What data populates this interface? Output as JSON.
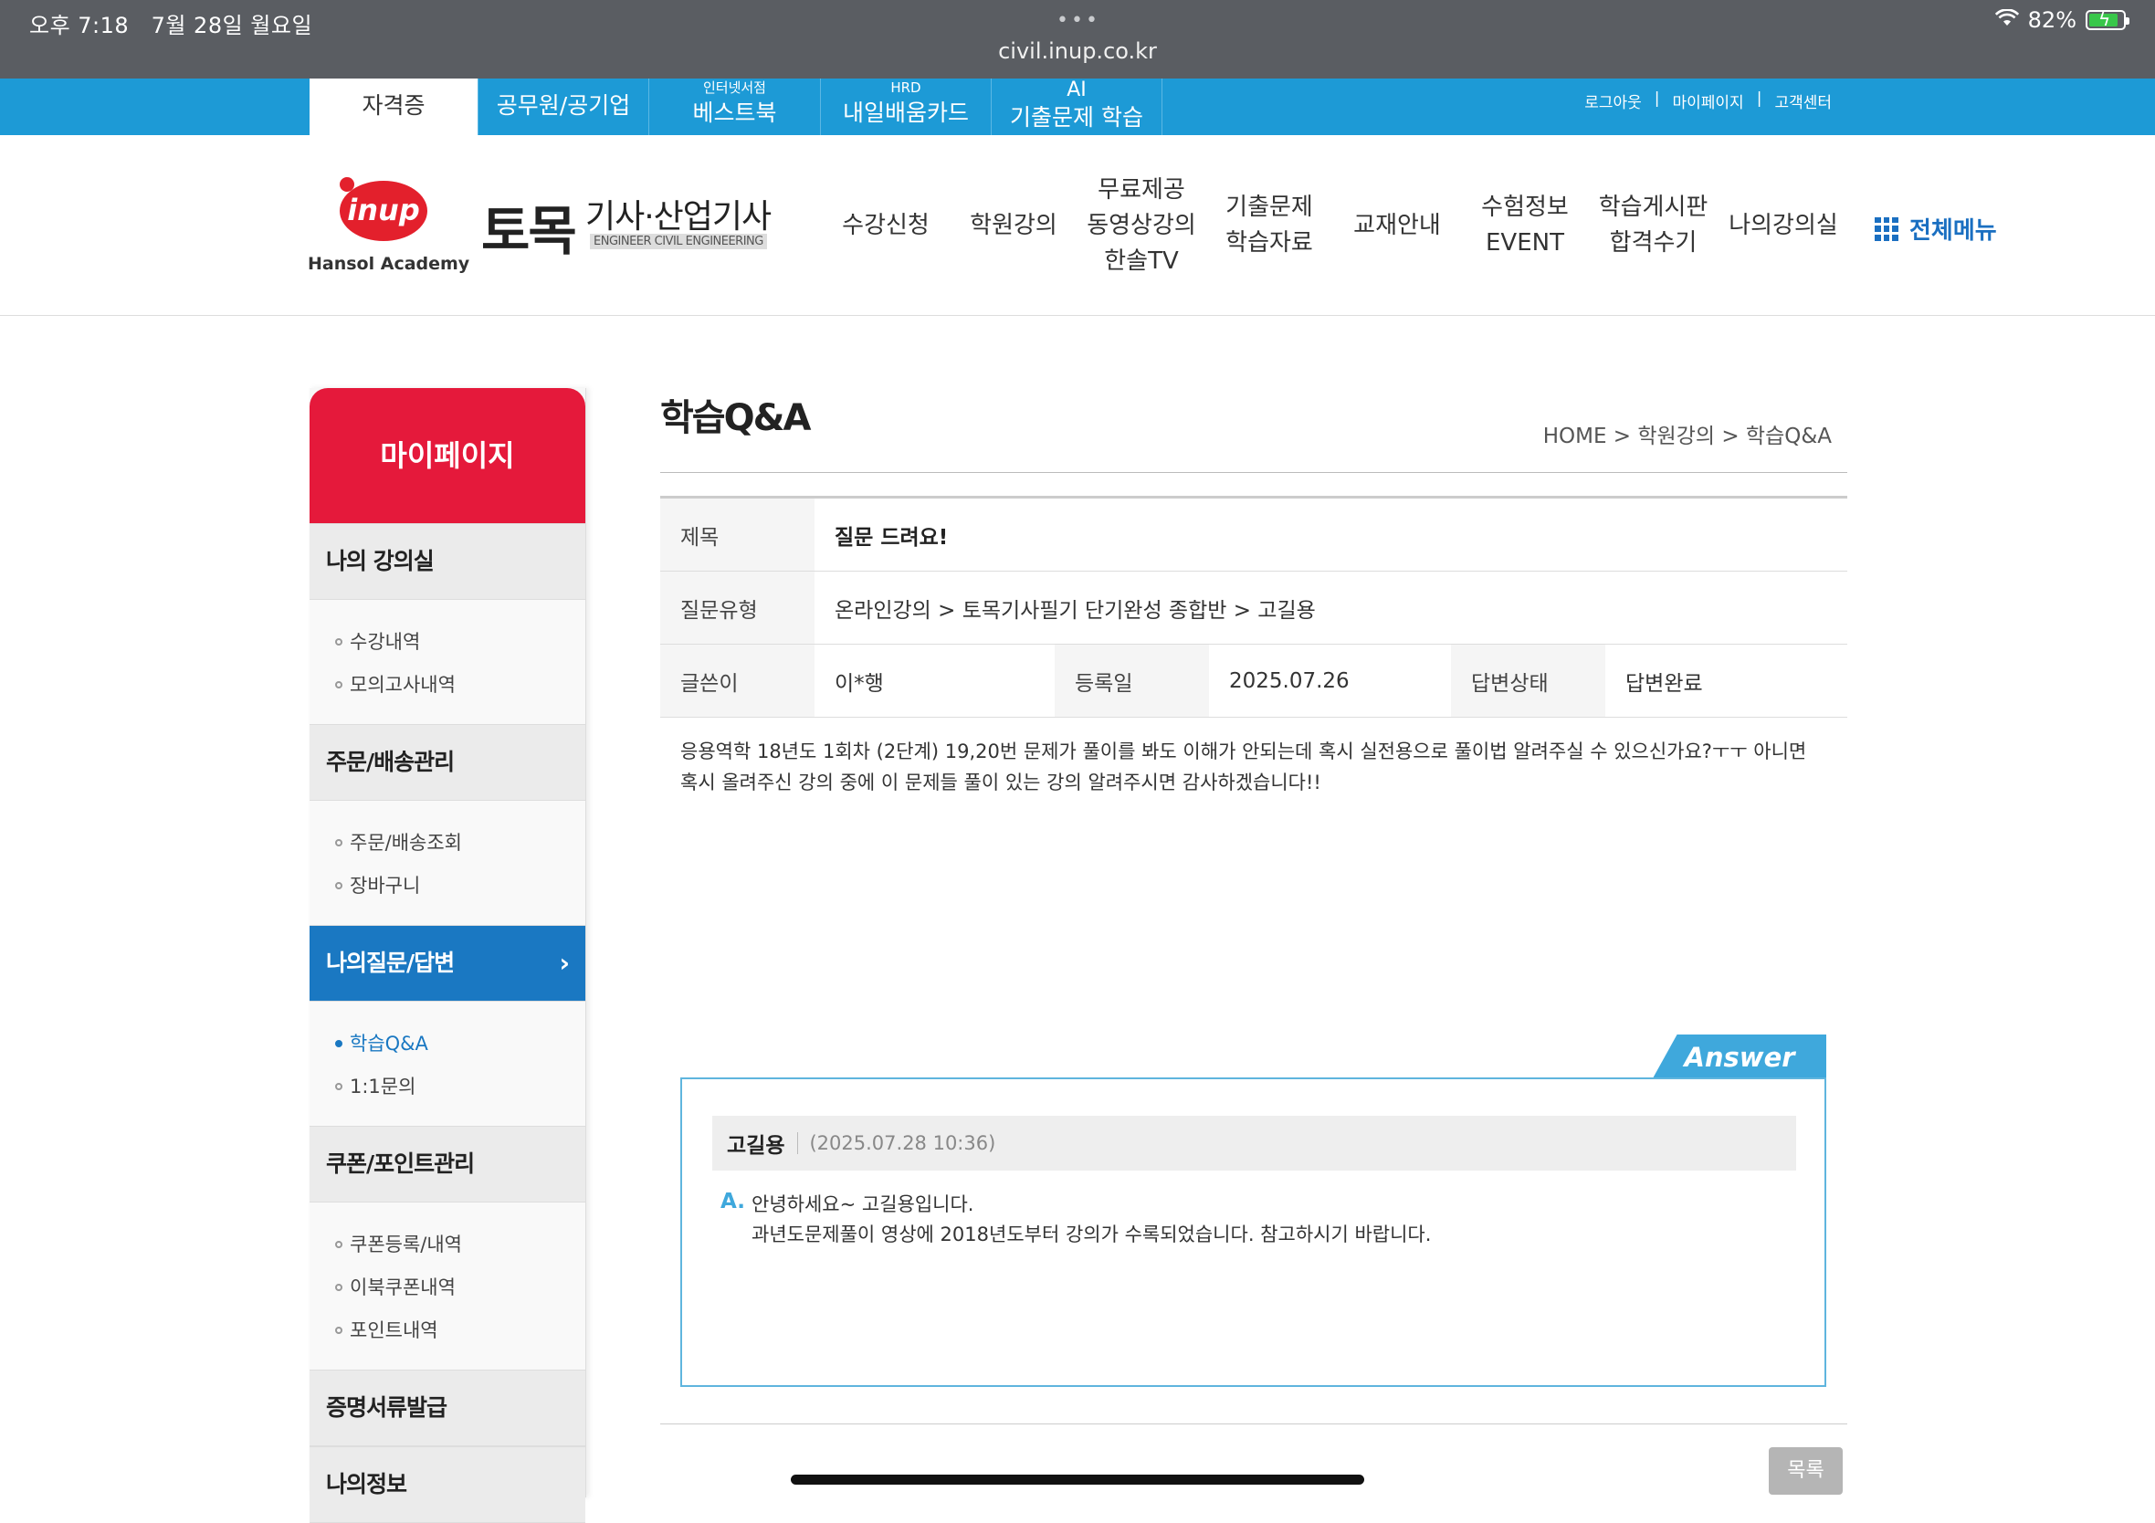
{
  "status": {
    "time": "오후 7:18",
    "date": "7월 28일 월요일",
    "url": "civil.inup.co.kr",
    "battery": "82%"
  },
  "topbar": {
    "tabs": [
      {
        "label": "자격증",
        "sub": ""
      },
      {
        "label": "공무원/공기업",
        "sub": ""
      },
      {
        "label": "베스트북",
        "sub": "인터넷서점"
      },
      {
        "label": "내일배움카드",
        "sub": "HRD"
      },
      {
        "label": "기출문제 학습",
        "sub": "AI"
      }
    ],
    "links": [
      "로그아웃",
      "|",
      "마이페이지",
      "|",
      "고객센터"
    ]
  },
  "header": {
    "logo": "inup",
    "logo_sub": "Hansol Academy",
    "brand_main": "토목",
    "brand_side": "기사·산업기사",
    "brand_eng": "ENGINEER CIVIL ENGINEERING",
    "nav": [
      [
        "수강신청"
      ],
      [
        "학원강의"
      ],
      [
        "무료제공",
        "동영상강의",
        "한솔TV"
      ],
      [
        "기출문제",
        "학습자료"
      ],
      [
        "교재안내"
      ],
      [
        "수험정보",
        "EVENT"
      ],
      [
        "학습게시판",
        "합격수기"
      ],
      [
        "나의강의실"
      ]
    ],
    "all_menu": "전체메뉴"
  },
  "sidebar": {
    "title": "마이페이지",
    "sections": [
      {
        "label": "나의 강의실",
        "items": [
          "수강내역",
          "모의고사내역"
        ]
      },
      {
        "label": "주문/배송관리",
        "items": [
          "주문/배송조회",
          "장바구니"
        ]
      },
      {
        "label": "나의질문/답변",
        "items": [
          "학습Q&A",
          "1:1문의"
        ]
      },
      {
        "label": "쿠폰/포인트관리",
        "items": [
          "쿠폰등록/내역",
          "이북쿠폰내역",
          "포인트내역"
        ]
      },
      {
        "label": "증명서류발급",
        "items": []
      },
      {
        "label": "나의정보",
        "items": []
      }
    ]
  },
  "page": {
    "title": "학습Q&A",
    "breadcrumb": "HOME > 학원강의 > 학습Q&A"
  },
  "question": {
    "subject_label": "제목",
    "subject": "질문 드려요!",
    "type_label": "질문유형",
    "type": "온라인강의 > 토목기사필기 단기완성 종합반 > 고길용",
    "author_label": "글쓴이",
    "author": "이*행",
    "date_label": "등록일",
    "date": "2025.07.26",
    "status_label": "답변상태",
    "status": "답변완료",
    "body_line1": "응용역학 18년도 1회차 (2단계) 19,20번 문제가 풀이를 봐도 이해가 안되는데 혹시 실전용으로 풀이법 알려주실 수 있으신가요?ㅜㅜ 아니면",
    "body_line2": "혹시 올려주신 강의 중에 이 문제들 풀이 있는 강의 알려주시면 감사하겠습니다!!"
  },
  "answer": {
    "tab": "Answer",
    "name": "고길용",
    "date": "(2025.07.28 10:36)",
    "prefix": "A.",
    "line1": "안녕하세요~ 고길용입니다.",
    "line2": "과년도문제풀이 영상에 2018년도부터 강의가 수록되었습니다. 참고하시기 바랍니다."
  },
  "buttons": {
    "list": "목록"
  }
}
